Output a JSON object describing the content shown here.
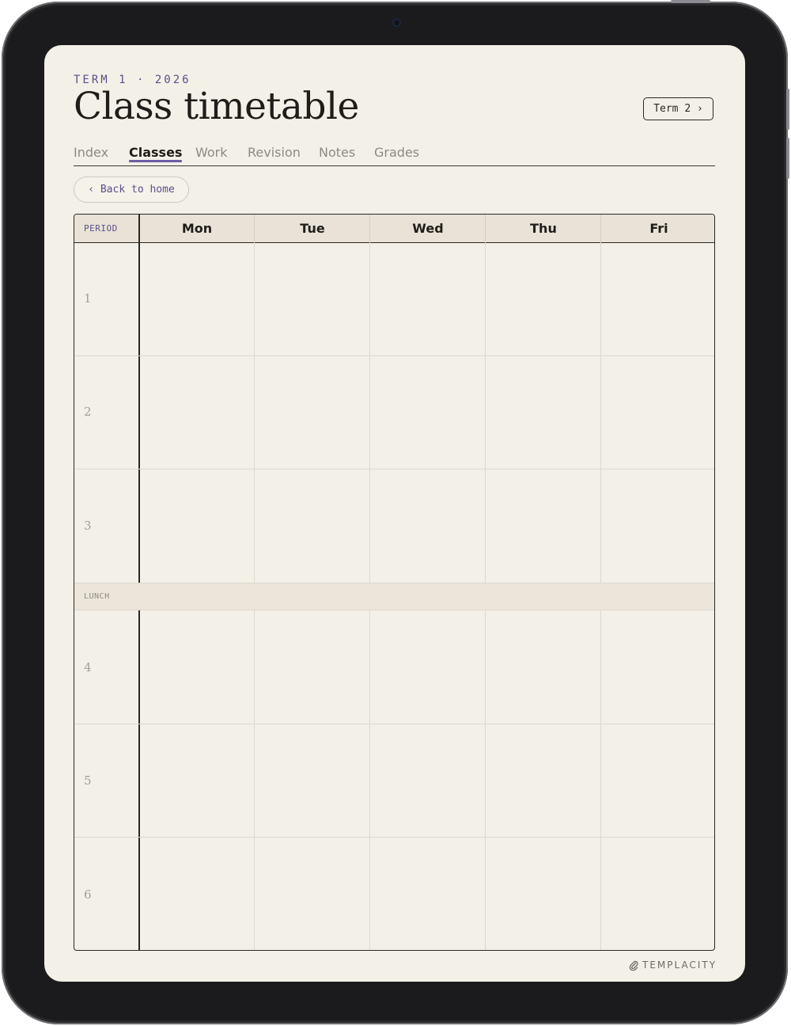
{
  "header": {
    "eyebrow": "TERM 1 · 2026",
    "title": "Class timetable",
    "term_button": "Term 2 ›"
  },
  "tabs": [
    {
      "label": "Index",
      "active": false
    },
    {
      "label": "Classes",
      "active": true
    },
    {
      "label": "Work",
      "active": false
    },
    {
      "label": "Revision",
      "active": false
    },
    {
      "label": "Notes",
      "active": false
    },
    {
      "label": "Grades",
      "active": false
    }
  ],
  "back_button": "‹ Back to home",
  "timetable": {
    "period_header": "PERIOD",
    "days": [
      "Mon",
      "Tue",
      "Wed",
      "Thu",
      "Fri"
    ],
    "periods_before_lunch": [
      "1",
      "2",
      "3"
    ],
    "lunch_label": "LUNCH",
    "periods_after_lunch": [
      "4",
      "5",
      "6"
    ]
  },
  "footer": {
    "brand": "TEMPLACITY",
    "brand_icon": "paperclip-icon"
  },
  "colors": {
    "accent": "#5b4f8c",
    "paper": "#f3f0e7",
    "ink": "#1f1d19"
  }
}
